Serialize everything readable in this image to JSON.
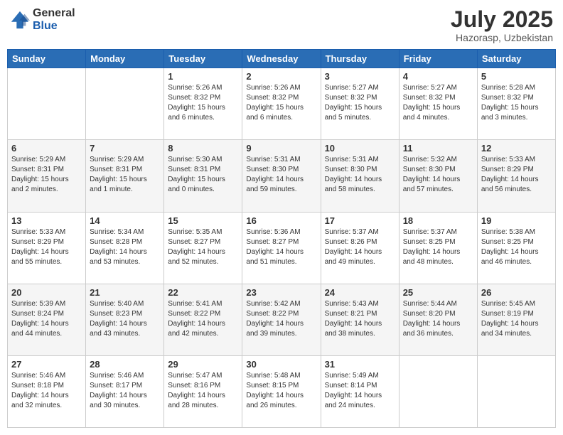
{
  "logo": {
    "general": "General",
    "blue": "Blue"
  },
  "title": "July 2025",
  "location": "Hazorasp, Uzbekistan",
  "days_of_week": [
    "Sunday",
    "Monday",
    "Tuesday",
    "Wednesday",
    "Thursday",
    "Friday",
    "Saturday"
  ],
  "weeks": [
    [
      {
        "num": "",
        "detail": ""
      },
      {
        "num": "",
        "detail": ""
      },
      {
        "num": "1",
        "detail": "Sunrise: 5:26 AM\nSunset: 8:32 PM\nDaylight: 15 hours and 6 minutes."
      },
      {
        "num": "2",
        "detail": "Sunrise: 5:26 AM\nSunset: 8:32 PM\nDaylight: 15 hours and 6 minutes."
      },
      {
        "num": "3",
        "detail": "Sunrise: 5:27 AM\nSunset: 8:32 PM\nDaylight: 15 hours and 5 minutes."
      },
      {
        "num": "4",
        "detail": "Sunrise: 5:27 AM\nSunset: 8:32 PM\nDaylight: 15 hours and 4 minutes."
      },
      {
        "num": "5",
        "detail": "Sunrise: 5:28 AM\nSunset: 8:32 PM\nDaylight: 15 hours and 3 minutes."
      }
    ],
    [
      {
        "num": "6",
        "detail": "Sunrise: 5:29 AM\nSunset: 8:31 PM\nDaylight: 15 hours and 2 minutes."
      },
      {
        "num": "7",
        "detail": "Sunrise: 5:29 AM\nSunset: 8:31 PM\nDaylight: 15 hours and 1 minute."
      },
      {
        "num": "8",
        "detail": "Sunrise: 5:30 AM\nSunset: 8:31 PM\nDaylight: 15 hours and 0 minutes."
      },
      {
        "num": "9",
        "detail": "Sunrise: 5:31 AM\nSunset: 8:30 PM\nDaylight: 14 hours and 59 minutes."
      },
      {
        "num": "10",
        "detail": "Sunrise: 5:31 AM\nSunset: 8:30 PM\nDaylight: 14 hours and 58 minutes."
      },
      {
        "num": "11",
        "detail": "Sunrise: 5:32 AM\nSunset: 8:30 PM\nDaylight: 14 hours and 57 minutes."
      },
      {
        "num": "12",
        "detail": "Sunrise: 5:33 AM\nSunset: 8:29 PM\nDaylight: 14 hours and 56 minutes."
      }
    ],
    [
      {
        "num": "13",
        "detail": "Sunrise: 5:33 AM\nSunset: 8:29 PM\nDaylight: 14 hours and 55 minutes."
      },
      {
        "num": "14",
        "detail": "Sunrise: 5:34 AM\nSunset: 8:28 PM\nDaylight: 14 hours and 53 minutes."
      },
      {
        "num": "15",
        "detail": "Sunrise: 5:35 AM\nSunset: 8:27 PM\nDaylight: 14 hours and 52 minutes."
      },
      {
        "num": "16",
        "detail": "Sunrise: 5:36 AM\nSunset: 8:27 PM\nDaylight: 14 hours and 51 minutes."
      },
      {
        "num": "17",
        "detail": "Sunrise: 5:37 AM\nSunset: 8:26 PM\nDaylight: 14 hours and 49 minutes."
      },
      {
        "num": "18",
        "detail": "Sunrise: 5:37 AM\nSunset: 8:25 PM\nDaylight: 14 hours and 48 minutes."
      },
      {
        "num": "19",
        "detail": "Sunrise: 5:38 AM\nSunset: 8:25 PM\nDaylight: 14 hours and 46 minutes."
      }
    ],
    [
      {
        "num": "20",
        "detail": "Sunrise: 5:39 AM\nSunset: 8:24 PM\nDaylight: 14 hours and 44 minutes."
      },
      {
        "num": "21",
        "detail": "Sunrise: 5:40 AM\nSunset: 8:23 PM\nDaylight: 14 hours and 43 minutes."
      },
      {
        "num": "22",
        "detail": "Sunrise: 5:41 AM\nSunset: 8:22 PM\nDaylight: 14 hours and 42 minutes."
      },
      {
        "num": "23",
        "detail": "Sunrise: 5:42 AM\nSunset: 8:22 PM\nDaylight: 14 hours and 39 minutes."
      },
      {
        "num": "24",
        "detail": "Sunrise: 5:43 AM\nSunset: 8:21 PM\nDaylight: 14 hours and 38 minutes."
      },
      {
        "num": "25",
        "detail": "Sunrise: 5:44 AM\nSunset: 8:20 PM\nDaylight: 14 hours and 36 minutes."
      },
      {
        "num": "26",
        "detail": "Sunrise: 5:45 AM\nSunset: 8:19 PM\nDaylight: 14 hours and 34 minutes."
      }
    ],
    [
      {
        "num": "27",
        "detail": "Sunrise: 5:46 AM\nSunset: 8:18 PM\nDaylight: 14 hours and 32 minutes."
      },
      {
        "num": "28",
        "detail": "Sunrise: 5:46 AM\nSunset: 8:17 PM\nDaylight: 14 hours and 30 minutes."
      },
      {
        "num": "29",
        "detail": "Sunrise: 5:47 AM\nSunset: 8:16 PM\nDaylight: 14 hours and 28 minutes."
      },
      {
        "num": "30",
        "detail": "Sunrise: 5:48 AM\nSunset: 8:15 PM\nDaylight: 14 hours and 26 minutes."
      },
      {
        "num": "31",
        "detail": "Sunrise: 5:49 AM\nSunset: 8:14 PM\nDaylight: 14 hours and 24 minutes."
      },
      {
        "num": "",
        "detail": ""
      },
      {
        "num": "",
        "detail": ""
      }
    ]
  ]
}
